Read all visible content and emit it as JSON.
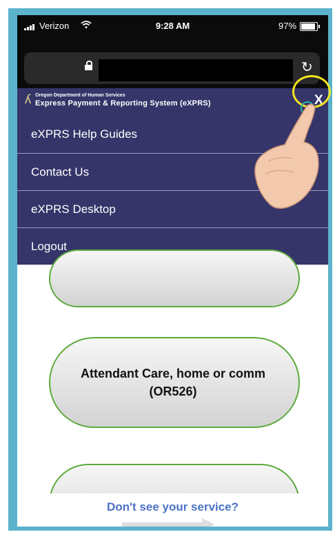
{
  "status_bar": {
    "carrier": "Verizon",
    "time": "9:28 AM",
    "battery_percent": "97%",
    "battery_level": 0.97
  },
  "browser": {
    "lock_icon": "lock-icon",
    "reload_icon": "reload-icon"
  },
  "header": {
    "org_name": "Oregon Department of Human Services",
    "system_name": "Express Payment & Reporting System (eXPRS)",
    "close_label": "X"
  },
  "menu": {
    "items": [
      {
        "label": "eXPRS Help Guides"
      },
      {
        "label": "Contact Us"
      },
      {
        "label": "eXPRS Desktop"
      },
      {
        "label": "Logout"
      }
    ]
  },
  "services": {
    "second_line1": "Attendant Care, home or comm",
    "second_line2": "(OR526)"
  },
  "footer": {
    "no_service_link": "Don't see your service?"
  },
  "colors": {
    "frame": "#5bb3cc",
    "menu_bg": "#35356a",
    "button_border": "#5daa3c",
    "link": "#4a72c4",
    "highlight": "#f4e51e"
  }
}
